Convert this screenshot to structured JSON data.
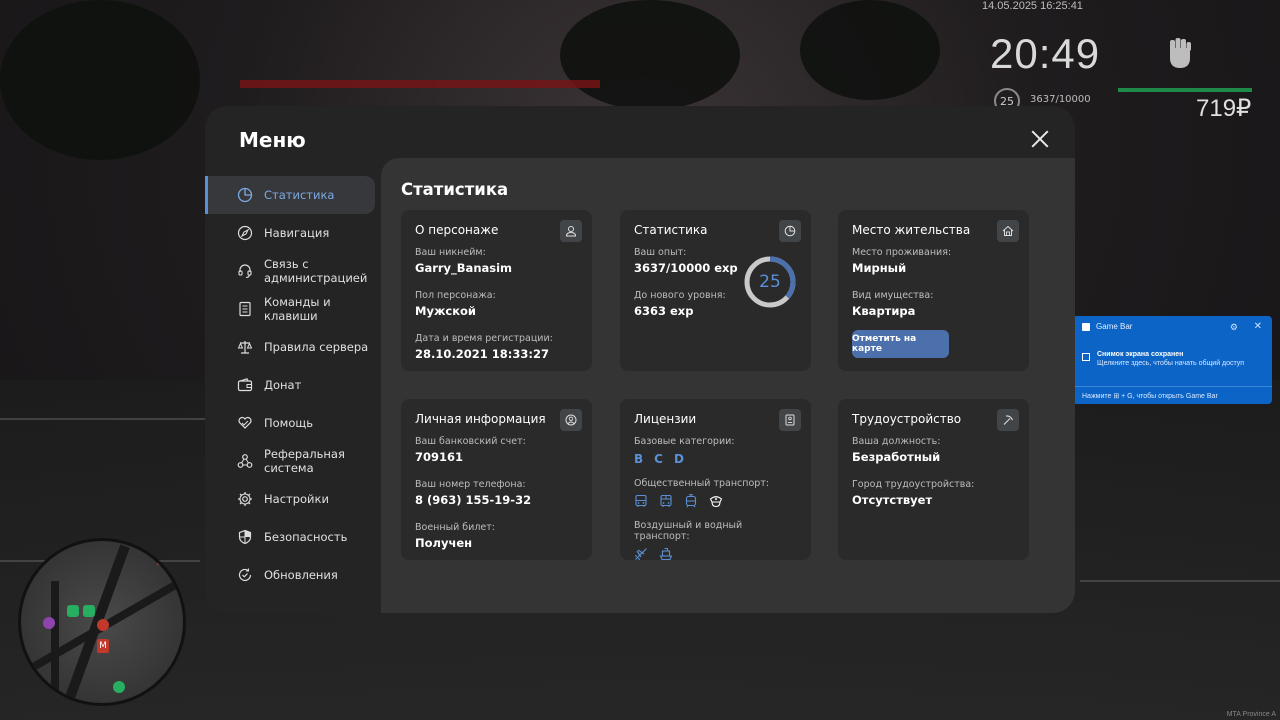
{
  "hud": {
    "date": "14.05.2025 16:25:41",
    "time": "20:49",
    "level": "25",
    "exp": "3637/10000",
    "money": "719₽"
  },
  "minimap": {
    "markers": [
      "metro-icon",
      "metro-icon",
      "shop-icon",
      "shop-icon"
    ]
  },
  "gamebar": {
    "app": "Game Bar",
    "title": "Снимок экрана сохранен",
    "subtitle": "Щелкните здесь, чтобы начать общий доступ",
    "footer": "Нажмите ⊞ + G, чтобы открыть Game Bar"
  },
  "watermark": "MTA Province A",
  "menu": {
    "title": "Меню",
    "sidebar": [
      {
        "label": "Статистика",
        "icon": "pie-chart-icon",
        "active": true
      },
      {
        "label": "Навигация",
        "icon": "compass-icon"
      },
      {
        "label": "Связь с администрацией",
        "icon": "headset-icon"
      },
      {
        "label": "Команды и клавиши",
        "icon": "document-icon"
      },
      {
        "label": "Правила сервера",
        "icon": "scales-icon"
      },
      {
        "label": "Донат",
        "icon": "wallet-icon"
      },
      {
        "label": "Помощь",
        "icon": "heart-hands-icon"
      },
      {
        "label": "Реферальная система",
        "icon": "share-icon"
      },
      {
        "label": "Настройки",
        "icon": "gear-icon"
      },
      {
        "label": "Безопасность",
        "icon": "shield-icon"
      },
      {
        "label": "Обновления",
        "icon": "refresh-check-icon"
      }
    ],
    "section_title": "Статистика",
    "cards": {
      "character": {
        "title": "О персонаже",
        "nickname_label": "Ваш никнейм:",
        "nickname": "Garry_Banasim",
        "gender_label": "Пол персонажа:",
        "gender": "Мужской",
        "reg_label": "Дата и время регистрации:",
        "reg": "28.10.2021 18:33:27"
      },
      "stats": {
        "title": "Статистика",
        "exp_label": "Ваш опыт:",
        "exp": "3637/10000 exp",
        "next_label": "До нового уровня:",
        "next": "6363 exp",
        "level": "25",
        "progress": 0.3637
      },
      "residence": {
        "title": "Место жительства",
        "place_label": "Место проживания:",
        "place": "Мирный",
        "property_label": "Вид имущества:",
        "property": "Квартира",
        "button": "Отметить на карте"
      },
      "personal": {
        "title": "Личная информация",
        "bank_label": "Ваш банковский счет:",
        "bank": "709161",
        "phone_label": "Ваш номер телефона:",
        "phone": "8 (963) 155-19-32",
        "military_label": "Военный билет:",
        "military": "Получен"
      },
      "licenses": {
        "title": "Лицензии",
        "base_label": "Базовые категории:",
        "base": [
          "B",
          "C",
          "D"
        ],
        "public_label": "Общественный транспорт:",
        "public_icons": [
          "bus-icon",
          "bus-icon",
          "tram-icon",
          "captain-hat-icon"
        ],
        "air_label": "Воздушный и водный транспорт:",
        "air_icons": [
          "plane-icon",
          "boat-icon"
        ]
      },
      "employment": {
        "title": "Трудоустройство",
        "position_label": "Ваша должность:",
        "position": "Безработный",
        "city_label": "Город трудоустройства:",
        "city": "Отсутствует"
      }
    }
  },
  "colors": {
    "accent": "#5b8fd6",
    "button": "#4c70ab",
    "card": "#2a2a2a",
    "panel": "#343434"
  }
}
